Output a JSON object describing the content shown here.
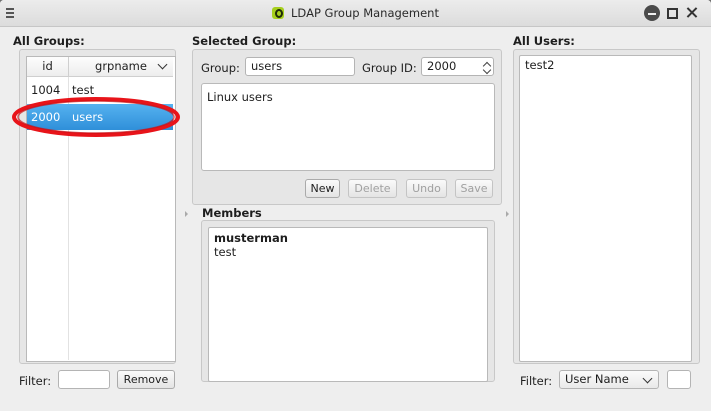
{
  "window": {
    "title": "LDAP Group Management"
  },
  "all_groups": {
    "label": "All Groups:",
    "columns": [
      "id",
      "grpname"
    ],
    "rows": [
      {
        "id": "1004",
        "grpname": "test",
        "selected": false
      },
      {
        "id": "2000",
        "grpname": "users",
        "selected": true
      }
    ],
    "filter_label": "Filter:",
    "filter_value": "",
    "remove_label": "Remove"
  },
  "selected_group": {
    "label": "Selected Group:",
    "group_label": "Group:",
    "group_value": "users",
    "group_id_label": "Group ID:",
    "group_id_value": "2000",
    "description": "Linux users",
    "new_label": "New",
    "delete_label": "Delete",
    "undo_label": "Undo",
    "save_label": "Save",
    "members_label": "Members",
    "members": [
      "musterman",
      "test"
    ]
  },
  "all_users": {
    "label": "All Users:",
    "users": [
      "test2"
    ],
    "filter_label": "Filter:",
    "filter_field": "User Name",
    "filter_value": ""
  },
  "colors": {
    "selection": "#3d9ee6",
    "annotation": "#e8141a",
    "app_icon": "#a6cf1e"
  }
}
